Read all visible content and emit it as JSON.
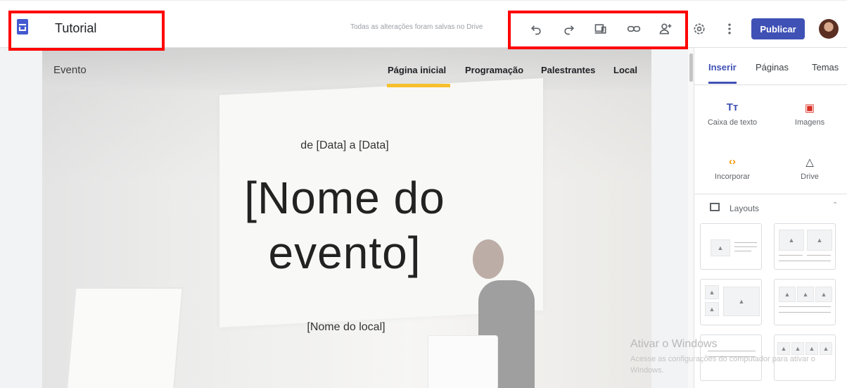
{
  "header": {
    "doc_title": "Tutorial",
    "save_status": "Todas as alterações foram salvas no Drive",
    "publish_label": "Publicar",
    "icons": [
      "undo-icon",
      "redo-icon",
      "preview-icon",
      "link-icon",
      "share-icon",
      "settings-icon",
      "more-vert-icon"
    ],
    "highlight_color": "#ff0000"
  },
  "site": {
    "brand": "Evento",
    "nav": [
      {
        "label": "Página inicial",
        "active": true
      },
      {
        "label": "Programação",
        "active": false
      },
      {
        "label": "Palestrantes",
        "active": false
      },
      {
        "label": "Local",
        "active": false
      }
    ],
    "dates": "de [Data] a [Data]",
    "title_line1": "[Nome do",
    "title_line2": "evento]",
    "venue": "[Nome do local]",
    "accent_color": "#f6c02d"
  },
  "panel": {
    "tabs": [
      {
        "label": "Inserir",
        "active": true
      },
      {
        "label": "Páginas",
        "active": false
      },
      {
        "label": "Temas",
        "active": false
      }
    ],
    "insert_items": [
      {
        "label": "Caixa de texto",
        "icon": "text-box-icon",
        "glyph": "Tт"
      },
      {
        "label": "Imagens",
        "icon": "image-icon",
        "glyph": "▣"
      },
      {
        "label": "Incorporar",
        "icon": "embed-icon",
        "glyph": "‹›"
      },
      {
        "label": "Drive",
        "icon": "drive-icon",
        "glyph": "△"
      }
    ],
    "layouts_label": "Layouts"
  },
  "watermark": {
    "title": "Ativar o Windows",
    "subtitle": "Acesse as configurações do computador para ativar o Windows."
  }
}
